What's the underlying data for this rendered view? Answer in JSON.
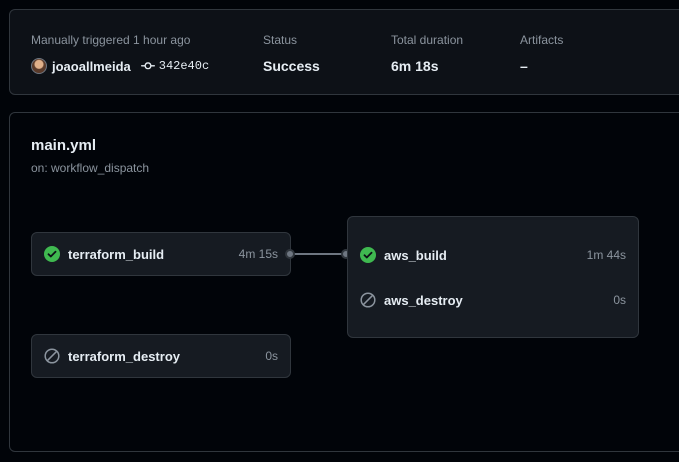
{
  "summary": {
    "trigger_label": "Manually triggered 1 hour ago",
    "actor": "joaoallmeida",
    "commit_sha": "342e40c",
    "status_label": "Status",
    "status_value": "Success",
    "duration_label": "Total duration",
    "duration_value": "6m 18s",
    "artifacts_label": "Artifacts",
    "artifacts_value": "–"
  },
  "workflow": {
    "file": "main.yml",
    "trigger": "on: workflow_dispatch"
  },
  "jobs": {
    "terraform_build": {
      "name": "terraform_build",
      "duration": "4m 15s",
      "status": "success"
    },
    "terraform_destroy": {
      "name": "terraform_destroy",
      "duration": "0s",
      "status": "skipped"
    },
    "aws_build": {
      "name": "aws_build",
      "duration": "1m 44s",
      "status": "success"
    },
    "aws_destroy": {
      "name": "aws_destroy",
      "duration": "0s",
      "status": "skipped"
    }
  },
  "colors": {
    "success": "#3fb950",
    "skipped": "#8b949e",
    "background": "#010409",
    "panel": "#0d1117",
    "job_card": "#161b22",
    "border": "#30363d"
  },
  "icons": {
    "success": "check-circle-fill-icon",
    "skipped": "skip-icon",
    "commit": "git-commit-icon"
  }
}
